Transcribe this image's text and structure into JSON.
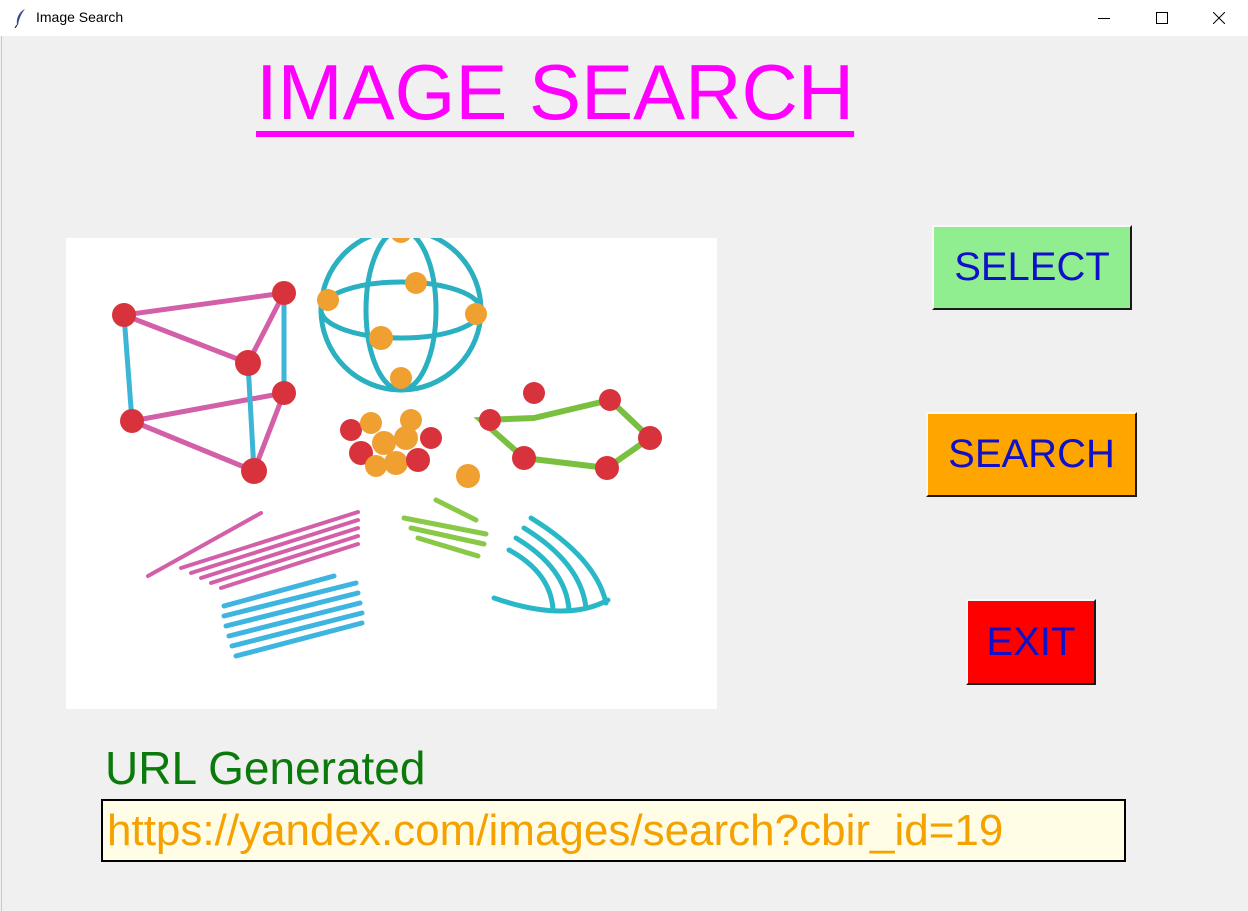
{
  "window": {
    "title": "Image Search",
    "icon": "feather-icon",
    "controls": [
      "minimize-icon",
      "maximize-icon",
      "close-icon"
    ]
  },
  "heading": "IMAGE SEARCH",
  "buttons": {
    "select": "SELECT",
    "search": "SEARCH",
    "exit": "EXIT"
  },
  "button_colors": {
    "select": "#90ee90",
    "search": "#ffa500",
    "exit": "#ff0000",
    "text": "#1010c8"
  },
  "colors": {
    "heading": "#ff00ff",
    "url_label": "#0a7a0a",
    "url_text": "#f5a100",
    "url_bg": "#fffde6"
  },
  "url": {
    "label": "URL Generated",
    "value": "https://yandex.com/images/search?cbir_id=19"
  }
}
